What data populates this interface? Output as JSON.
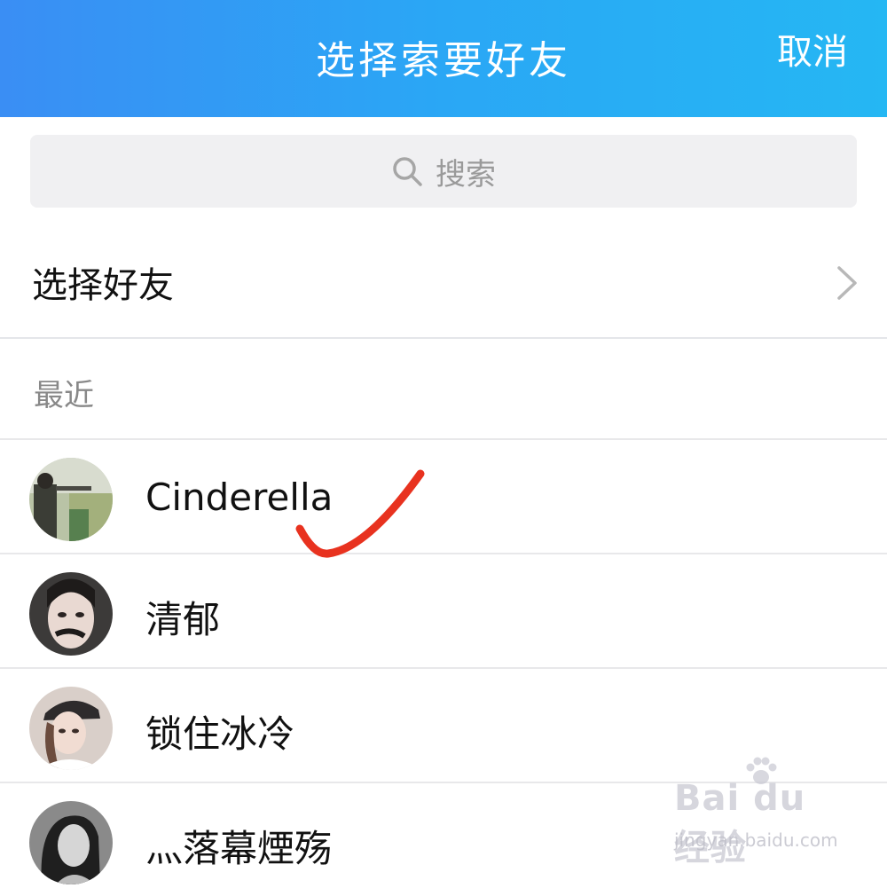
{
  "header": {
    "title": "选择索要好友",
    "cancel_label": "取消",
    "gradient_colors": [
      "#3a8ef4",
      "#25b7f3"
    ]
  },
  "search": {
    "icon": "search-icon",
    "placeholder": "搜索"
  },
  "select_friends": {
    "label": "选择好友",
    "icon": "chevron-right-icon"
  },
  "recent": {
    "section_label": "最近",
    "contacts": [
      {
        "name": "Cinderella",
        "avatar": "avatar-photo"
      },
      {
        "name": "清郁",
        "avatar": "avatar-photo"
      },
      {
        "name": "锁住冰冷",
        "avatar": "avatar-photo"
      },
      {
        "name": "灬落幕煙殇",
        "avatar": "avatar-photo"
      }
    ]
  },
  "annotation": {
    "icon": "checkmark-icon",
    "color": "#e8321f"
  },
  "watermark": {
    "logo": "Bai du 经验",
    "url": "jingyan.baidu.com"
  }
}
